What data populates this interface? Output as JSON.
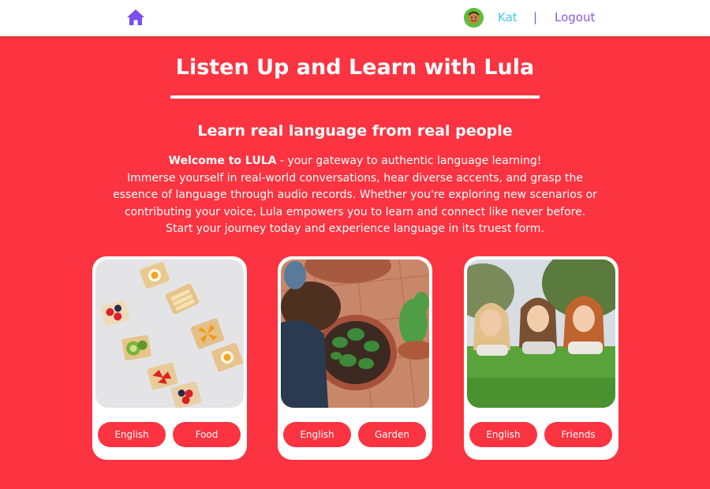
{
  "nav": {
    "user_name": "Kat",
    "divider": "|",
    "logout_label": "Logout",
    "icons": [
      "home-icon",
      "avatar"
    ]
  },
  "hero": {
    "title": "Listen Up and Learn with Lula",
    "subtitle": "Learn real language from real people",
    "intro_bold": "Welcome to LULA",
    "intro_line1_rest": " - your gateway to authentic language learning!",
    "intro_line2": "Immerse yourself in real-world conversations, hear diverse accents, and grasp the",
    "intro_line3": "essence of language through audio records. Whether you're exploring new scenarios or",
    "intro_line4": "contributing your voice, Lula empowers you to learn and connect like never before.",
    "intro_line5": "Start your journey today and experience language in its truest form."
  },
  "cards": [
    {
      "language": "English",
      "topic": "Food"
    },
    {
      "language": "English",
      "topic": "Garden"
    },
    {
      "language": "English",
      "topic": "Friends"
    }
  ],
  "colors": {
    "background": "#fc3340",
    "language_name_link": "#44c7e8",
    "logout_link": "#8b57e6",
    "home_icon": "#7b4ff0",
    "card": "#ffffff"
  }
}
